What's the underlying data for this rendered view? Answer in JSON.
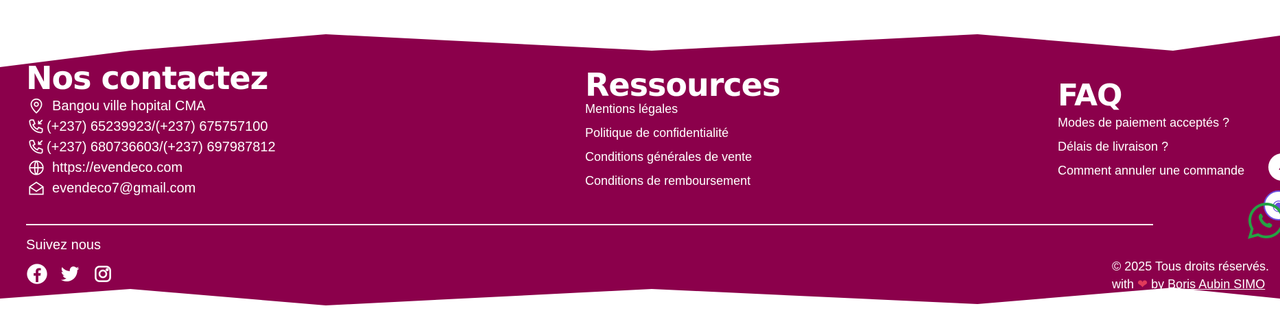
{
  "colors": {
    "footer_bg": "#8b004b",
    "text": "#ffffff",
    "whatsapp": "#25a244",
    "heart": "#e03a5a",
    "chat": "#6c4ddf"
  },
  "contact": {
    "title": "Nos contactez",
    "address": "Bangou ville hopital CMA",
    "phone1": "(+237) 65239923/(+237) 675757100",
    "phone2": "(+237) 680736603/(+237) 697987812",
    "website": "https://evendeco.com",
    "email": "evendeco7@gmail.com"
  },
  "resources": {
    "title": "Ressources",
    "links": [
      "Mentions légales",
      "Politique de confidentialité",
      "Conditions générales de vente",
      "Conditions de remboursement"
    ]
  },
  "faq": {
    "title": "FAQ",
    "links": [
      "Modes de paiement acceptés ?",
      "Délais de livraison ?",
      "Comment annuler une commande"
    ]
  },
  "follow": {
    "label": "Suivez nous",
    "icons": [
      "facebook-icon",
      "twitter-icon",
      "instagram-icon"
    ]
  },
  "copyright": {
    "line1": "© 2025 Tous droits réservés.",
    "with": "with",
    "by": "by",
    "author": "Boris Aubin SIMO"
  }
}
